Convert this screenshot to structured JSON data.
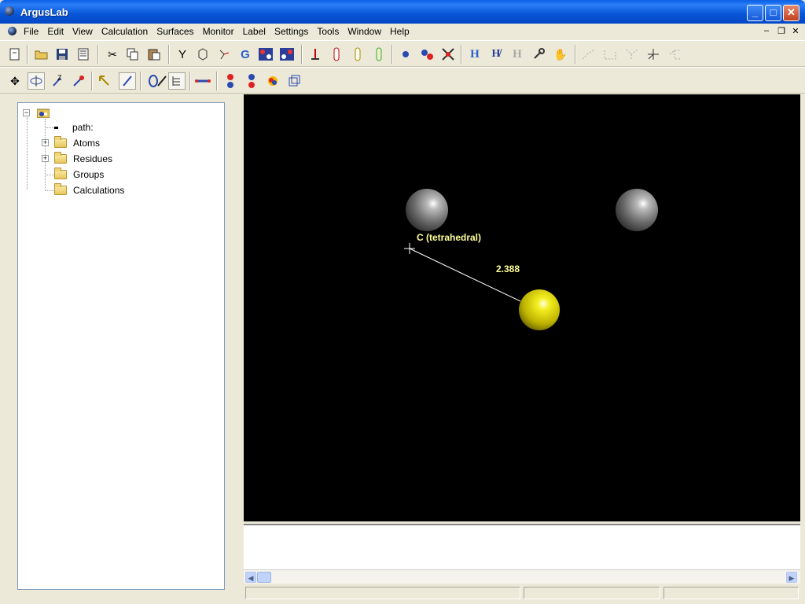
{
  "window": {
    "title": "ArgusLab"
  },
  "menu": [
    "File",
    "Edit",
    "View",
    "Calculation",
    "Surfaces",
    "Monitor",
    "Label",
    "Settings",
    "Tools",
    "Window",
    "Help"
  ],
  "tree": {
    "path_label": "path:",
    "items": [
      {
        "label": "Atoms",
        "expandable": true
      },
      {
        "label": "Residues",
        "expandable": true
      },
      {
        "label": "Groups",
        "expandable": false
      },
      {
        "label": "Calculations",
        "expandable": false
      }
    ]
  },
  "viewport": {
    "atom_label": "C (tetrahedral)",
    "distance": "2.388",
    "colors": {
      "carbon": "#777777",
      "sulfur": "#e6e000",
      "label": "#ffff99",
      "background": "#000000"
    }
  },
  "toolbar1_icons": [
    "new-icon",
    "open-icon",
    "save-icon",
    "print-icon",
    "cut-icon",
    "copy-icon",
    "paste-icon",
    "y-fragment-icon",
    "ring-icon",
    "bond-icon",
    "g-icon",
    "molecule-icon",
    "molecule-alt-icon",
    "stick-icon",
    "tube1-icon",
    "tube2-icon",
    "tube3-icon",
    "atom-ball-icon",
    "add-atom-icon",
    "delete-atom-icon",
    "add-hydrogen-icon",
    "hydrogen-edit-icon",
    "hydrogen-gray-icon",
    "wrench-icon",
    "hand-icon",
    "bond-gray1-icon",
    "bond-gray2-icon",
    "bond-gray3-icon",
    "axis-icon",
    "bond-gray4-icon"
  ],
  "toolbar2_icons": [
    "translate-icon",
    "rotate-icon",
    "zoom-icon",
    "select-icon",
    "pointer-icon",
    "draw-icon",
    "ring-draw-icon",
    "pencil-icon",
    "hierarchy-icon",
    "bond-measure-icon",
    "ball-stick-icon",
    "ball-stick-alt-icon",
    "surface-icon",
    "box-icon"
  ]
}
